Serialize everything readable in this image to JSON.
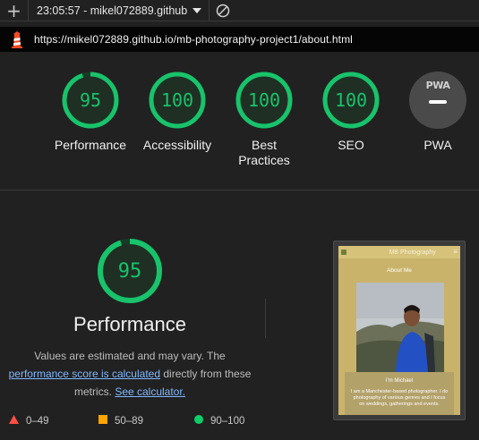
{
  "toolbar": {
    "add_icon": "plus-icon",
    "report_select": "23:05:57 - mikel072889.github",
    "clear_icon": "clear-icon"
  },
  "url": {
    "favicon": "lighthouse-icon",
    "text": "https://mikel072889.github.io/mb-photography-project1/about.html"
  },
  "scores": [
    {
      "label": "Performance",
      "value": "95",
      "score": 0.95
    },
    {
      "label": "Accessibility",
      "value": "100",
      "score": 1.0
    },
    {
      "label": "Best Practices",
      "value": "100",
      "score": 1.0
    },
    {
      "label": "SEO",
      "value": "100",
      "score": 1.0
    }
  ],
  "pwa": {
    "label": "PWA",
    "badge_text": "PWA"
  },
  "performance": {
    "score": "95",
    "score_fraction": 0.95,
    "title": "Performance",
    "desc_1": "Values are estimated and may vary. The",
    "link_1": "performance score is calculated",
    "desc_2": "directly from these",
    "desc_3": "metrics.",
    "link_2": "See calculator."
  },
  "legend": [
    {
      "range": "0–49",
      "symbol": "triangle",
      "color": "#ff4e42"
    },
    {
      "range": "50–89",
      "symbol": "square",
      "color": "#ffa400"
    },
    {
      "range": "90–100",
      "symbol": "circle",
      "color": "#0cce6b"
    }
  ],
  "thumbnail": {
    "site_title": "MB Photography",
    "heading": "About Me",
    "name": "I'm Michael",
    "bio": "I am a Manchester-based photographer. I do photography of various genres and I focus on weddings, gatherings and events."
  },
  "colors": {
    "pass": "#18c36b",
    "background": "#212121"
  }
}
